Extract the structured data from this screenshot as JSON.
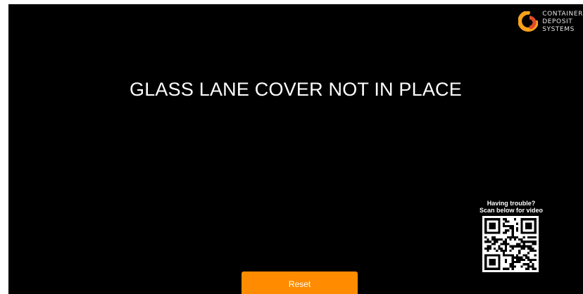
{
  "brand": {
    "lines": [
      "CONTAINER",
      "DEPOSIT",
      "SYSTEMS"
    ],
    "icon": "cds-logo-icon",
    "colors": {
      "ring": "#f7a21b",
      "core": "#e04a2a"
    }
  },
  "message": "GLASS LANE COVER NOT IN PLACE",
  "help": {
    "line1": "Having trouble?",
    "line2": "Scan below for video",
    "qr_icon": "qr-code-icon"
  },
  "reset_button": {
    "label": "Reset",
    "color": "#ff8c00"
  },
  "colors": {
    "background": "#000000",
    "text": "#ffffff"
  }
}
